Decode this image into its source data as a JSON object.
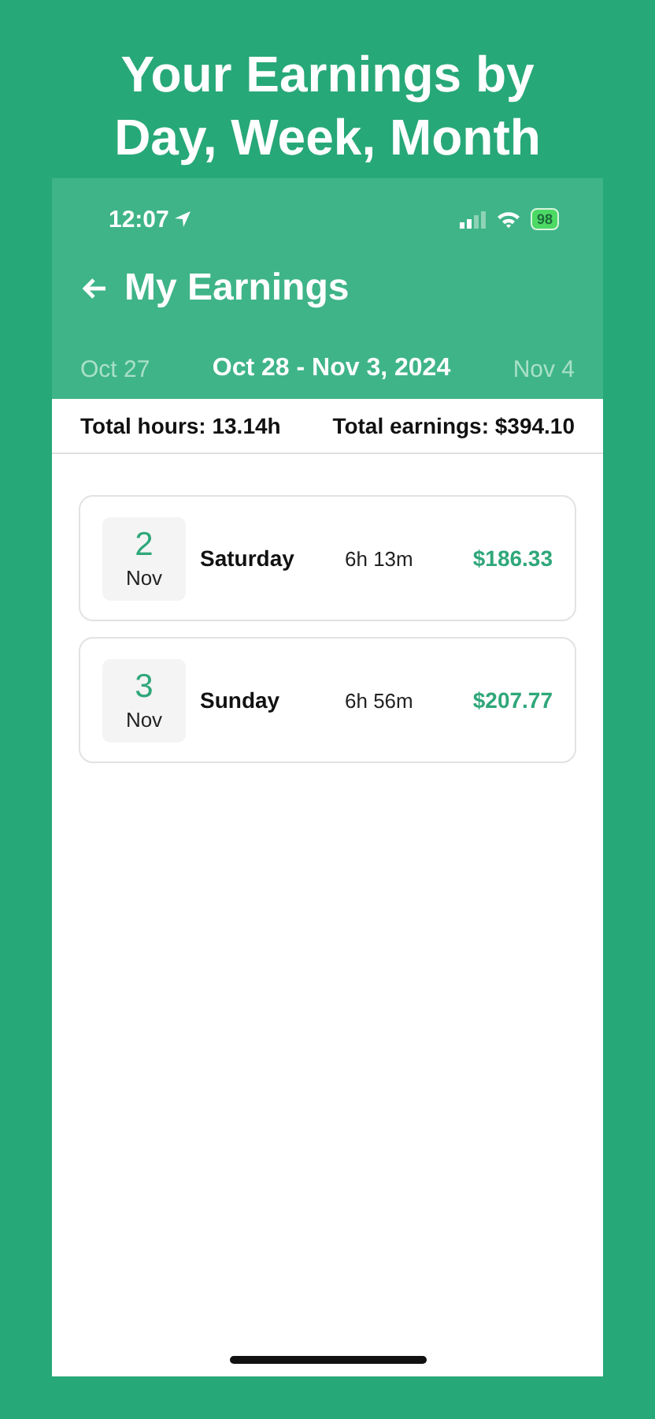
{
  "headline": "Your Earnings by Day, Week, Month",
  "status_bar": {
    "time": "12:07",
    "battery": "98"
  },
  "header": {
    "title": "My Earnings"
  },
  "week_nav": {
    "previous": "Oct 27",
    "current": "Oct 28 - Nov 3, 2024",
    "next": "Nov 4"
  },
  "summary": {
    "hours": "Total hours: 13.14h",
    "earnings": "Total earnings: $394.10"
  },
  "days": [
    {
      "day": "2",
      "month": "Nov",
      "weekday": "Saturday",
      "duration": "6h 13m",
      "amount": "$186.33"
    },
    {
      "day": "3",
      "month": "Nov",
      "weekday": "Sunday",
      "duration": "6h 56m",
      "amount": "$207.77"
    }
  ]
}
